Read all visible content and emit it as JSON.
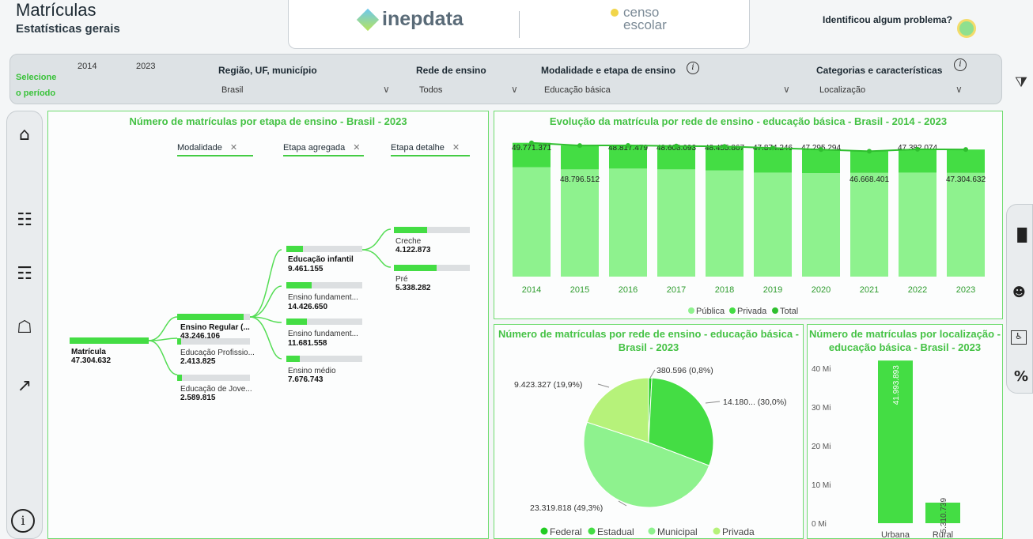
{
  "header": {
    "title": "Matrículas",
    "subtitle": "Estatísticas gerais",
    "logo_inep": "inepdata",
    "logo_censo_line1": "censo",
    "logo_censo_line2": "escolar",
    "problem_link": "Identificou algum problema?"
  },
  "filters": {
    "period_label": "Selecione o período",
    "year_start": "2014",
    "year_end": "2023",
    "regiao_label": "Região, UF, município",
    "regiao_value": "Brasil",
    "rede_label": "Rede de ensino",
    "rede_value": "Todos",
    "modalidade_label": "Modalidade e etapa de ensino",
    "modalidade_value": "Educação básica",
    "categorias_label": "Categorias e características",
    "categorias_value": "Localização"
  },
  "tree": {
    "title": "Número de matrículas por etapa de ensino - Brasil - 2023",
    "chips": [
      "Modalidade",
      "Etapa agregada",
      "Etapa detalhe"
    ],
    "root": {
      "label": "Matrícula",
      "value": "47.304.632"
    },
    "level1": [
      {
        "label": "Ensino Regular (...",
        "value": "43.246.106",
        "fill": 0.91,
        "bold": true
      },
      {
        "label": "Educação Profissio...",
        "value": "2.413.825",
        "fill": 0.05,
        "bold": false
      },
      {
        "label": "Educação de Jove...",
        "value": "2.589.815",
        "fill": 0.06,
        "bold": false
      }
    ],
    "level2": [
      {
        "label": "Educação infantil",
        "value": "9.461.155",
        "fill": 0.22,
        "bold": true
      },
      {
        "label": "Ensino fundament...",
        "value": "14.426.650",
        "fill": 0.33,
        "bold": false
      },
      {
        "label": "Ensino fundament...",
        "value": "11.681.558",
        "fill": 0.27,
        "bold": false
      },
      {
        "label": "Ensino médio",
        "value": "7.676.743",
        "fill": 0.18,
        "bold": false
      }
    ],
    "level3": [
      {
        "label": "Creche",
        "value": "4.122.873",
        "fill": 0.44
      },
      {
        "label": "Pré",
        "value": "5.338.282",
        "fill": 0.56
      }
    ]
  },
  "chart_data": [
    {
      "type": "bar",
      "title": "Evolução da matrícula por rede de ensino - educação básica - Brasil - 2014 - 2023",
      "categories": [
        "2014",
        "2015",
        "2016",
        "2017",
        "2018",
        "2019",
        "2020",
        "2021",
        "2022",
        "2023"
      ],
      "series": [
        {
          "name": "Pública",
          "values": [
            40.7,
            39.9,
            40.2,
            39.9,
            39.5,
            38.7,
            38.5,
            38.6,
            38.7,
            38.6
          ]
        },
        {
          "name": "Privada",
          "values": [
            9.1,
            8.9,
            8.6,
            8.7,
            8.9,
            9.2,
            8.8,
            8.1,
            8.7,
            8.7
          ]
        },
        {
          "name": "Total",
          "values": [
            49771371,
            48796512,
            48817479,
            48608093,
            48455867,
            47874246,
            47295294,
            46668401,
            47382074,
            47304632
          ]
        }
      ],
      "total_labels": [
        "49.771.371",
        "48.796.512",
        "48.817.479",
        "48.608.093",
        "48.455.867",
        "47.874.246",
        "47.295.294",
        "46.668.401",
        "47.382.074",
        "47.304.632"
      ],
      "legend": [
        "Pública",
        "Privada",
        "Total"
      ],
      "colors": {
        "Pública": "#8ef28e",
        "Privada": "#44dd44",
        "Total": "#2fbf2f"
      },
      "legend_position": "bottom"
    },
    {
      "type": "pie",
      "title": "Número de matrículas por rede de ensino - educação básica - Brasil - 2023",
      "categories": [
        "Federal",
        "Estadual",
        "Municipal",
        "Privada"
      ],
      "values": [
        0.8,
        30.0,
        49.3,
        19.9
      ],
      "labels": [
        "380.596 (0,8%)",
        "14.180... (30,0%)",
        "23.319.818 (49,3%)",
        "9.423.327 (19,9%)"
      ],
      "colors": [
        "#22cc22",
        "#44dd44",
        "#8ef28e",
        "#b6f27a"
      ],
      "legend_position": "bottom"
    },
    {
      "type": "bar",
      "title": "Número de matrículas por localização - educação básica - Brasil - 2023",
      "categories": [
        "Urbana",
        "Rural"
      ],
      "values": [
        41993893,
        5310739
      ],
      "value_labels": [
        "41.993.893",
        "5.310.739"
      ],
      "yticks": [
        "40 Mi",
        "30 Mi",
        "20 Mi",
        "10 Mi",
        "0 Mi"
      ],
      "ylim": [
        0,
        40000000
      ],
      "color": "#44dd44"
    }
  ]
}
